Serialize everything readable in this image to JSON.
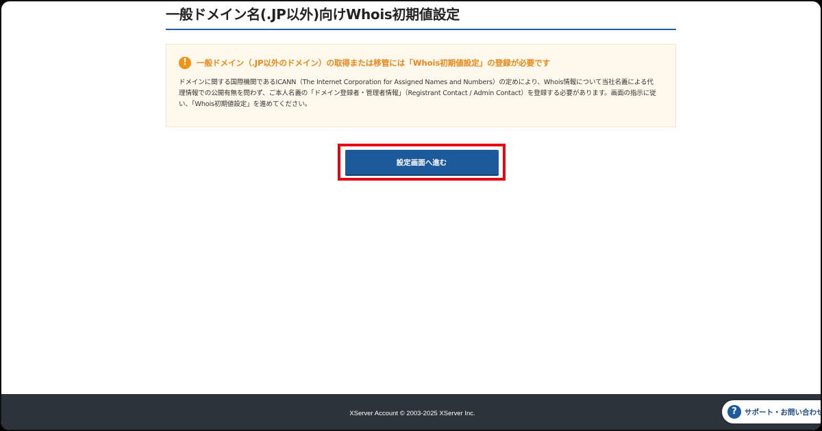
{
  "page": {
    "title": "一般ドメイン名(.JP以外)向けWhois初期値設定"
  },
  "notice": {
    "icon": "exclamation-icon",
    "title": "一般ドメイン（.JP以外のドメイン）の取得または移管には「Whois初期値設定」の登録が必要です",
    "body": "ドメインに関する国際機関であるICANN（The Internet Corporation for Assigned Names and Numbers）の定めにより、Whois情報について当社名義による代理情報での公開有無を問わず、ご本人名義の「ドメイン登録者・管理者情報」（Registrant Contact / Admin Contact）を登録する必要があります。画面の指示に従い、「Whois初期値設定」を進めてください。"
  },
  "actions": {
    "proceed_label": "設定画面へ進む"
  },
  "footer": {
    "copyright": "XServer Account © 2003-2025 XServer Inc."
  },
  "support": {
    "icon": "question-icon",
    "label": "サポート・お問い合わせ"
  },
  "colors": {
    "accent": "#1c5a9c",
    "warning": "#f29316",
    "highlight": "#e60012",
    "footer_bg": "#2c333b"
  }
}
